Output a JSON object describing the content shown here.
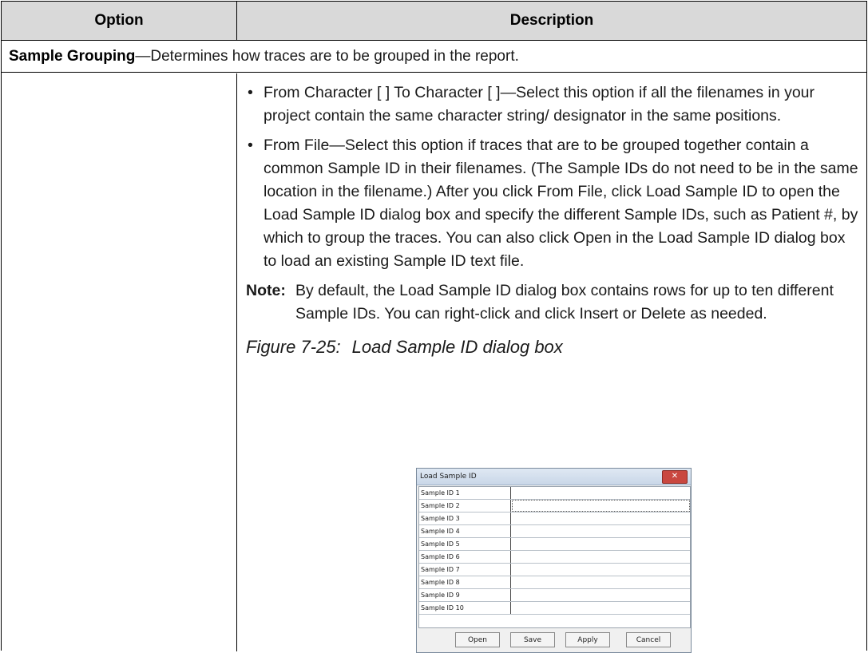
{
  "table": {
    "headers": {
      "option": "Option",
      "description": "Description"
    },
    "group_row": {
      "term": "Sample Grouping",
      "text": "—Determines how traces are to be grouped in the report."
    },
    "bullets": [
      "From Character [ ] To Character [ ]—Select this option if all the filenames in your project contain the same character string/ designator in the same positions.",
      "From File—Select this option if traces that are to be grouped together contain a common Sample ID in their filenames. (The Sample IDs do not need to be in the same location in the filename.) After you click From File, click Load Sample ID to open the Load Sample ID dialog box and specify the different Sample IDs, such as Patient #, by which to group the traces. You can also click Open in the Load Sample ID dialog box to load an existing Sample ID text file."
    ],
    "bullet_glyph": "•",
    "note": {
      "label": "Note:",
      "text": "By default, the Load Sample ID dialog box contains rows for up to ten different Sample IDs. You can right-click and click Insert or Delete as needed."
    },
    "caption": {
      "number": "Figure 7-25:",
      "title": "Load Sample ID dialog box"
    }
  },
  "dialog": {
    "title": "Load Sample ID",
    "close_glyph": "✕",
    "rows": [
      "Sample ID 1",
      "Sample ID 2",
      "Sample ID 3",
      "Sample ID 4",
      "Sample ID 5",
      "Sample ID 6",
      "Sample ID 7",
      "Sample ID 8",
      "Sample ID 9",
      "Sample ID 10"
    ],
    "buttons": {
      "open": "Open",
      "save": "Save",
      "apply": "Apply",
      "cancel": "Cancel"
    }
  }
}
